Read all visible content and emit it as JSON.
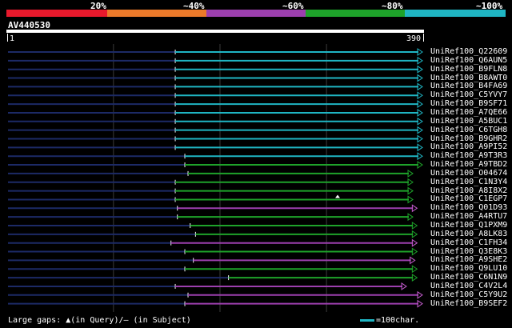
{
  "identity_scale": {
    "segments": [
      {
        "color": "#e8192c"
      },
      {
        "color": "#ec7a2a"
      },
      {
        "color": "#9c3fae"
      },
      {
        "color": "#1ea22a"
      },
      {
        "color": "#1fb5c3"
      }
    ],
    "labels": [
      "20%",
      "~40%",
      "~60%",
      "~80%",
      "~100%"
    ]
  },
  "query": {
    "name": "AV440530",
    "start": "1",
    "end": "390",
    "length": 390
  },
  "chart_data": {
    "type": "alignment",
    "x_unit": "query residue",
    "xlim": [
      1,
      390
    ],
    "hits": [
      {
        "name": "UniRef100_Q22609",
        "start": 158,
        "end": 390,
        "color": "#1fb5c3",
        "arrow": "#1fb5c3"
      },
      {
        "name": "UniRef100_Q6AUN5",
        "start": 158,
        "end": 390,
        "color": "#1fb5c3",
        "arrow": "#1fb5c3"
      },
      {
        "name": "UniRef100_B9FLN8",
        "start": 158,
        "end": 390,
        "color": "#1fb5c3",
        "arrow": "#1fb5c3"
      },
      {
        "name": "UniRef100_B8AWT0",
        "start": 158,
        "end": 390,
        "color": "#1fb5c3",
        "arrow": "#1fb5c3"
      },
      {
        "name": "UniRef100_B4FA69",
        "start": 158,
        "end": 390,
        "color": "#1fb5c3",
        "arrow": "#1fb5c3"
      },
      {
        "name": "UniRef100_C5YVY7",
        "start": 158,
        "end": 390,
        "color": "#1fb5c3",
        "arrow": "#1fb5c3"
      },
      {
        "name": "UniRef100_B9SF71",
        "start": 158,
        "end": 390,
        "color": "#1fb5c3",
        "arrow": "#1fb5c3"
      },
      {
        "name": "UniRef100_A7QE66",
        "start": 158,
        "end": 390,
        "color": "#1fb5c3",
        "arrow": "#1fb5c3"
      },
      {
        "name": "UniRef100_A5BUC1",
        "start": 158,
        "end": 390,
        "color": "#1fb5c3",
        "arrow": "#1fb5c3"
      },
      {
        "name": "UniRef100_C6TGH8",
        "start": 158,
        "end": 390,
        "color": "#1fb5c3",
        "arrow": "#1fb5c3"
      },
      {
        "name": "UniRef100_B9GHR2",
        "start": 158,
        "end": 390,
        "color": "#1fb5c3",
        "arrow": "#1fb5c3"
      },
      {
        "name": "UniRef100_A9PI52",
        "start": 158,
        "end": 390,
        "color": "#1fb5c3",
        "arrow": "#1fb5c3"
      },
      {
        "name": "UniRef100_A9T3R3",
        "start": 167,
        "end": 390,
        "color": "#1fb5c3",
        "arrow": "#1fb5c3"
      },
      {
        "name": "UniRef100_A9TBD2",
        "start": 167,
        "end": 390,
        "color": "#1ea22a",
        "arrow": "#1ea22a"
      },
      {
        "name": "UniRef100_O04674",
        "start": 170,
        "end": 381,
        "color": "#1ea22a",
        "arrow": "#1ea22a"
      },
      {
        "name": "UniRef100_C1N3Y4",
        "start": 158,
        "end": 381,
        "color": "#1ea22a",
        "arrow": "#1ea22a"
      },
      {
        "name": "UniRef100_A8I8X2",
        "start": 158,
        "end": 381,
        "color": "#1ea22a",
        "arrow": "#1ea22a"
      },
      {
        "name": "UniRef100_C1EGP7",
        "start": 158,
        "end": 381,
        "color": "#1ea22a",
        "arrow": "#1ea22a"
      },
      {
        "name": "UniRef100_Q01D93",
        "start": 160,
        "end": 385,
        "color": "#9c3fae",
        "arrow": "#c25acb"
      },
      {
        "name": "UniRef100_A4RTU7",
        "start": 160,
        "end": 381,
        "color": "#1ea22a",
        "arrow": "#1ea22a"
      },
      {
        "name": "UniRef100_Q1PXM9",
        "start": 172,
        "end": 385,
        "color": "#1ea22a",
        "arrow": "#1ea22a"
      },
      {
        "name": "UniRef100_A8LK83",
        "start": 177,
        "end": 385,
        "color": "#1ea22a",
        "arrow": "#1ea22a"
      },
      {
        "name": "UniRef100_C1FH34",
        "start": 154,
        "end": 385,
        "color": "#9c3fae",
        "arrow": "#c25acb"
      },
      {
        "name": "UniRef100_Q3E8K3",
        "start": 167,
        "end": 385,
        "color": "#1ea22a",
        "arrow": "#1ea22a"
      },
      {
        "name": "UniRef100_A9SHE2",
        "start": 175,
        "end": 383,
        "color": "#9c3fae",
        "arrow": "#c25acb"
      },
      {
        "name": "UniRef100_Q9LU10",
        "start": 167,
        "end": 385,
        "color": "#1ea22a",
        "arrow": "#1ea22a"
      },
      {
        "name": "UniRef100_C6N1N9",
        "start": 208,
        "end": 385,
        "color": "#1ea22a",
        "arrow": "#1ea22a"
      },
      {
        "name": "UniRef100_C4V2L4",
        "start": 158,
        "end": 375,
        "color": "#9c3fae",
        "arrow": "#c25acb"
      },
      {
        "name": "UniRef100_C5Y9U2",
        "start": 170,
        "end": 390,
        "color": "#9c3fae",
        "arrow": "#c25acb"
      },
      {
        "name": "UniRef100_B9SEF2",
        "start": 167,
        "end": 390,
        "color": "#9c3fae",
        "arrow": "#c25acb"
      }
    ],
    "gridlines_at": [
      100,
      200,
      300
    ]
  },
  "footer": {
    "gaps_text": "Large gaps: ▲(in Query)/– (in Subject)",
    "scale_text": "=100char.",
    "scale_color": "#1fb5c3"
  }
}
